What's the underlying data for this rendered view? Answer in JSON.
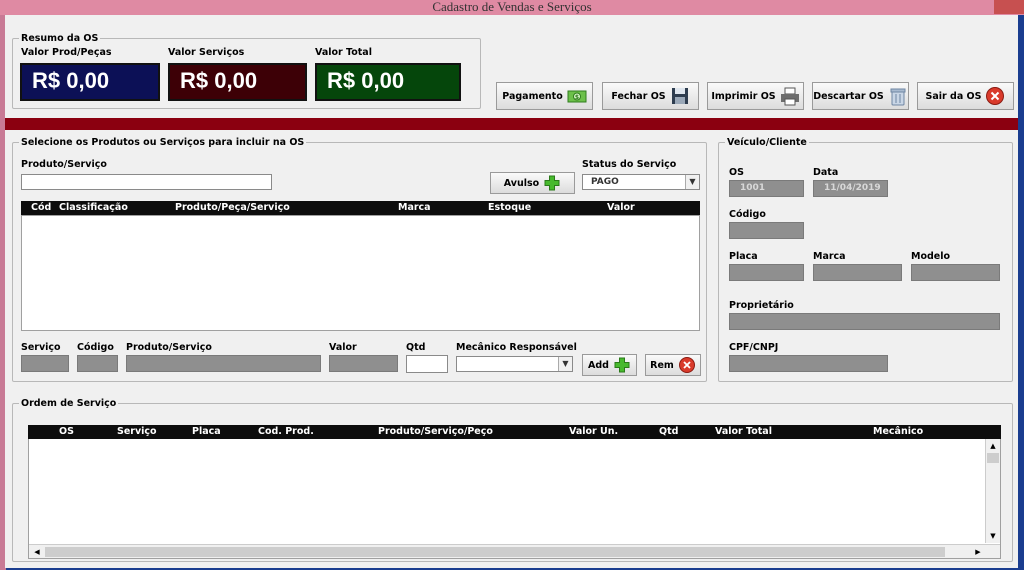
{
  "window": {
    "title": "Cadastro de Vendas e Serviços"
  },
  "resumo": {
    "legend": "Resumo da OS",
    "prod_label": "Valor Prod/Peças",
    "prod_value": "R$ 0,00",
    "serv_label": "Valor Serviços",
    "serv_value": "R$ 0,00",
    "total_label": "Valor Total",
    "total_value": "R$ 0,00",
    "colors": {
      "prod": "#0c1056",
      "serv": "#3d0006",
      "total": "#05460b"
    }
  },
  "toolbar": {
    "pagamento": "Pagamento",
    "fechar": "Fechar OS",
    "imprimir": "Imprimir OS",
    "descartar": "Descartar OS",
    "sair": "Sair da OS"
  },
  "produtos": {
    "legend": "Selecione os Produtos ou Serviços para incluir na OS",
    "search_label": "Produto/Serviço",
    "search_value": "",
    "avulso_label": "Avulso",
    "status_label": "Status do Serviço",
    "status_value": "PAGO",
    "columns": [
      "Cód",
      "Classificação",
      "Produto/Peça/Serviço",
      "Marca",
      "Estoque",
      "Valor"
    ],
    "rows": []
  },
  "item": {
    "servico_label": "Serviço",
    "codigo_label": "Código",
    "produto_label": "Produto/Serviço",
    "valor_label": "Valor",
    "qtd_label": "Qtd",
    "mecanico_label": "Mecânico Responsável",
    "add_label": "Add",
    "rem_label": "Rem"
  },
  "veiculo": {
    "legend": "Veículo/Cliente",
    "os_label": "OS",
    "os_value": "1001",
    "data_label": "Data",
    "data_value": "11/04/2019",
    "codigo_label": "Código",
    "placa_label": "Placa",
    "marca_label": "Marca",
    "modelo_label": "Modelo",
    "proprietario_label": "Proprietário",
    "cpf_label": "CPF/CNPJ"
  },
  "ordem": {
    "legend": "Ordem de Serviço",
    "columns": [
      "OS",
      "Serviço",
      "Placa",
      "Cod. Prod.",
      "Produto/Serviço/Peço",
      "Valor Un.",
      "Qtd",
      "Valor Total",
      "Mecânico"
    ],
    "rows": []
  }
}
